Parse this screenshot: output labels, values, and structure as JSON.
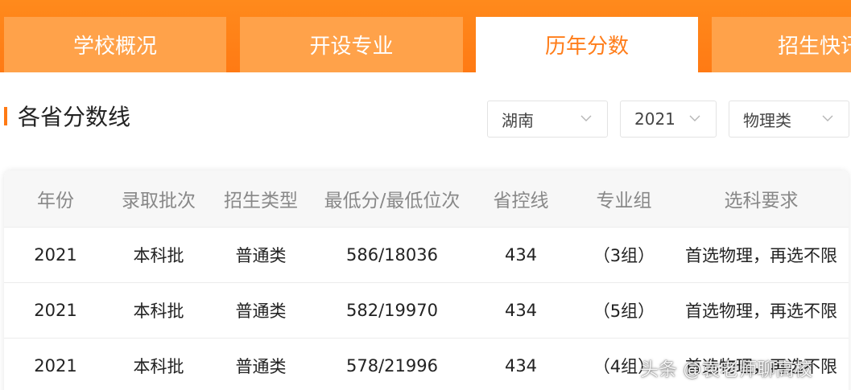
{
  "tabs": [
    {
      "label": "学校概况",
      "active": false
    },
    {
      "label": "开设专业",
      "active": false
    },
    {
      "label": "历年分数",
      "active": true
    },
    {
      "label": "招生快讯",
      "active": false
    }
  ],
  "section": {
    "title": "各省分数线"
  },
  "filters": {
    "province": "湖南",
    "year": "2021",
    "subject_type": "物理类"
  },
  "table": {
    "headers": [
      "年份",
      "录取批次",
      "招生类型",
      "最低分/最低位次",
      "省控线",
      "专业组",
      "选科要求"
    ],
    "rows": [
      [
        "2021",
        "本科批",
        "普通类",
        "586/18036",
        "434",
        "（3组）",
        "首选物理，再选不限"
      ],
      [
        "2021",
        "本科批",
        "普通类",
        "582/19970",
        "434",
        "（5组）",
        "首选物理，再选不限"
      ],
      [
        "2021",
        "本科批",
        "普通类",
        "578/21996",
        "434",
        "（4组）",
        "首选物理，再选不限"
      ]
    ]
  },
  "watermark": "头条 @袁老师聊高校",
  "colors": {
    "accent": "#ff7a14",
    "active_tab_text": "#ff7d1a",
    "inactive_tab_bg": "#ffa24a"
  },
  "icons": {
    "dropdown": "chevron-down-icon"
  }
}
